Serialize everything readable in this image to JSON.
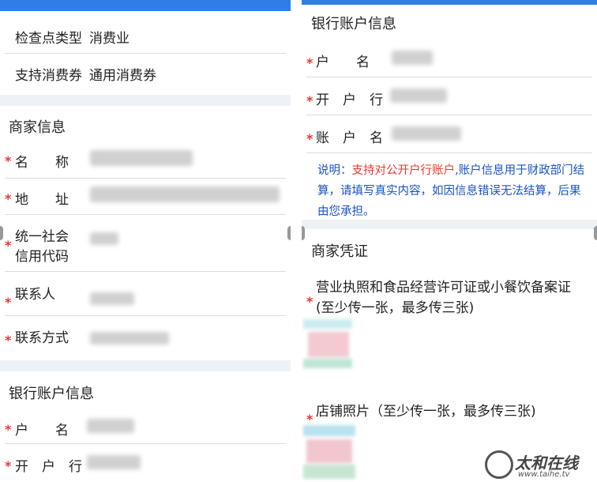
{
  "left": {
    "rows": [
      {
        "label": "检查点类型",
        "value": "消费业"
      },
      {
        "label": "支持消费券",
        "value": "通用消费券"
      }
    ],
    "merchant": {
      "title": "商家信息",
      "name_label": "名　　称",
      "address_label": "地　　址",
      "credit_label_line1": "统一社会",
      "credit_label_line2": "信用代码",
      "contact_label": "联系人",
      "phone_label": "联系方式"
    },
    "bank": {
      "title": "银行账户信息",
      "holder_label": "户　　名",
      "branch_label": "开　户　行"
    }
  },
  "right": {
    "bank": {
      "title": "银行账户信息",
      "holder_label": "户　　名",
      "branch_label": "开　户　行",
      "account_label": "账　户　名"
    },
    "note": {
      "prefix": "说明：",
      "highlight": "支持对公开户行账户",
      "body": ",账户信息用于财政部门结算，请填写真实内容，如因信息错误无法结算，后果由您承担。"
    },
    "voucher": {
      "title": "商家凭证",
      "license_line1": "营业执照和食品经营许可证或小餐饮备案证",
      "license_line2": "(至少传一张，最多传三张)",
      "store_label": "店铺照片（至少传一张，最多传三张)"
    }
  },
  "required_mark": "*",
  "watermark": {
    "name": "太和在线",
    "site": "www.taihe.tv"
  },
  "colors": {
    "accent": "#2f7ee8",
    "required": "#e33b2e",
    "note": "#1a52c0",
    "band": "#eef2f6"
  }
}
